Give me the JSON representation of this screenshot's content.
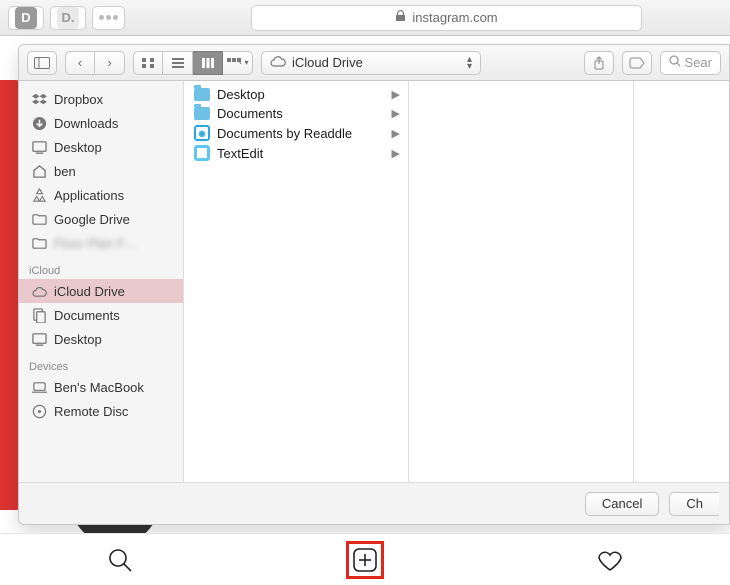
{
  "safari": {
    "url_host": "instagram.com"
  },
  "finder": {
    "current_location": "iCloud Drive",
    "search_placeholder": "Sear",
    "sidebar": {
      "favorites": [
        {
          "id": "dropbox",
          "label": "Dropbox",
          "icon": "dropbox"
        },
        {
          "id": "downloads",
          "label": "Downloads",
          "icon": "download"
        },
        {
          "id": "desktop",
          "label": "Desktop",
          "icon": "desktop"
        },
        {
          "id": "home",
          "label": "ben",
          "icon": "home"
        },
        {
          "id": "applications",
          "label": "Applications",
          "icon": "apps"
        },
        {
          "id": "gdrive",
          "label": "Google Drive",
          "icon": "folder"
        },
        {
          "id": "blurred",
          "label": "Floor Plan F…",
          "icon": "folder",
          "blurred": true
        }
      ],
      "icloud_header": "iCloud",
      "icloud": [
        {
          "id": "iclouddrive",
          "label": "iCloud Drive",
          "icon": "cloud",
          "selected": true
        },
        {
          "id": "documents",
          "label": "Documents",
          "icon": "doc"
        },
        {
          "id": "desktop2",
          "label": "Desktop",
          "icon": "desktop"
        }
      ],
      "devices_header": "Devices",
      "devices": [
        {
          "id": "mac",
          "label": "Ben's MacBook",
          "icon": "laptop"
        },
        {
          "id": "remotedisc",
          "label": "Remote Disc",
          "icon": "disc"
        }
      ]
    },
    "column_items": [
      {
        "label": "Desktop",
        "type": "folder"
      },
      {
        "label": "Documents",
        "type": "folder"
      },
      {
        "label": "Documents by Readdle",
        "type": "app"
      },
      {
        "label": "TextEdit",
        "type": "textedit"
      }
    ],
    "buttons": {
      "cancel": "Cancel",
      "choose": "Ch"
    }
  }
}
